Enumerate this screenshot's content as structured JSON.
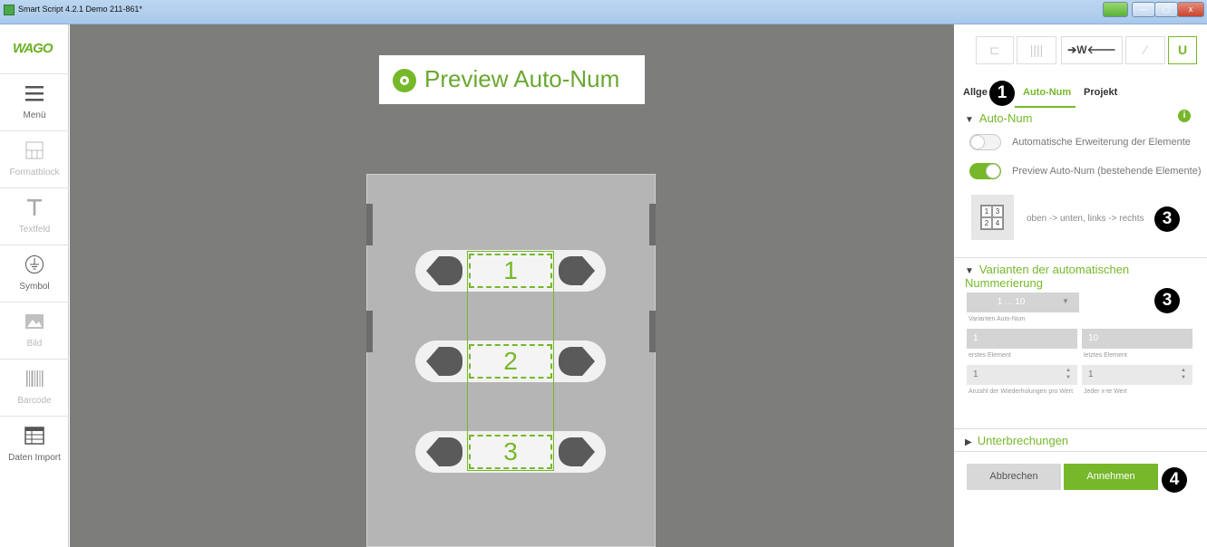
{
  "window": {
    "title": "Smart Script 4.2.1   Demo 211-861*",
    "min_label": "—",
    "max_label": "▢",
    "close_label": "x"
  },
  "brand": {
    "logo": "WAGO"
  },
  "left_tools": [
    {
      "label": "Menü",
      "icon": "menu-icon"
    },
    {
      "label": "Formatblock",
      "icon": "format-block-icon"
    },
    {
      "label": "Textfeld",
      "icon": "text-icon"
    },
    {
      "label": "Symbol",
      "icon": "ground-symbol-icon"
    },
    {
      "label": "Bild",
      "icon": "image-icon"
    },
    {
      "label": "Barcode",
      "icon": "barcode-icon"
    },
    {
      "label": "Daten Import",
      "icon": "table-import-icon"
    }
  ],
  "canvas": {
    "banner": "Preview Auto-Num",
    "cells": [
      "1",
      "2",
      "3"
    ]
  },
  "toolbar_buttons": [
    {
      "label": "⊏",
      "icon": "lock-open-icon"
    },
    {
      "label": "||||",
      "icon": "columns-icon"
    },
    {
      "label": "➔W🡐",
      "icon": "wago-fit-icon"
    },
    {
      "label": "⁄",
      "icon": "magic-wand-icon"
    },
    {
      "label": "U",
      "icon": "magnet-icon"
    }
  ],
  "tabs": {
    "general": "Allge",
    "autonum": "Auto-Num",
    "project": "Projekt"
  },
  "autonum": {
    "heading": "Auto-Num",
    "toggle1": "Automatische Erweiterung der Elemente",
    "toggle2": "Preview Auto-Num (bestehende Elemente)",
    "order_label": "oben -> unten, links -> rechts",
    "order_cells": [
      "1",
      "3",
      "2",
      "4"
    ]
  },
  "variants": {
    "heading": "Varianten der automatischen Nummerierung",
    "select_value": "1 ... 10",
    "select_label": "Varianten Auto-Num",
    "first_value": "1",
    "first_label": "erstes Element",
    "last_value": "10",
    "last_label": "letztes Element",
    "repeat_value": "1",
    "repeat_label": "Anzahl der Wiederholungen pro Wert",
    "nth_value": "1",
    "nth_label": "Jeder x-te Wert"
  },
  "interruptions": {
    "heading": "Unterbrechungen"
  },
  "actions": {
    "cancel": "Abbrechen",
    "apply": "Annehmen"
  },
  "badges": [
    "1",
    "3",
    "3",
    "4"
  ],
  "colors": {
    "accent": "#76b82a",
    "canvas": "#7d7d7b"
  }
}
